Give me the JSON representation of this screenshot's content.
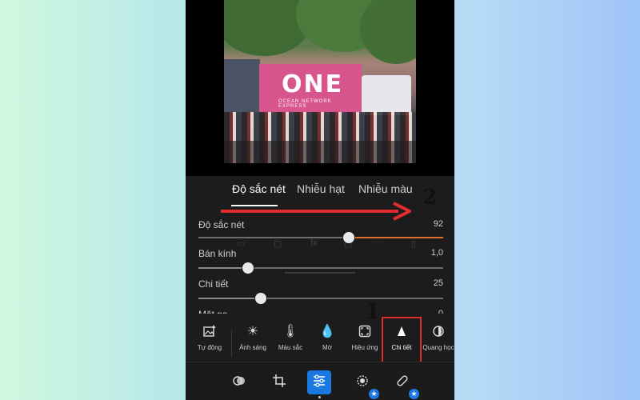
{
  "tabs": [
    "Độ sắc nét",
    "Nhiễu hạt",
    "Nhiễu màu"
  ],
  "active_tab": 0,
  "photo": {
    "container_logo": "ONE",
    "container_subtext": "OCEAN NETWORK EXPRESS"
  },
  "sliders": [
    {
      "label": "Độ sắc nét",
      "value": "92",
      "level": 0.92,
      "accent": true
    },
    {
      "label": "Bán kính",
      "value": "1,0",
      "level": 0.2,
      "accent": false
    },
    {
      "label": "Chi tiết",
      "value": "25",
      "level": 0.25,
      "accent": false
    },
    {
      "label": "Mặt nạ",
      "value": "0",
      "level": 0.0,
      "accent": false
    }
  ],
  "tools": [
    {
      "name": "tool-auto",
      "icon": "auto-photo-icon",
      "label": "Tự động"
    },
    {
      "name": "tool-light",
      "icon": "sun-icon",
      "label": "Ánh sáng"
    },
    {
      "name": "tool-color",
      "icon": "thermometer-icon",
      "label": "Màu sắc"
    },
    {
      "name": "tool-blur",
      "icon": "droplet-icon",
      "label": "Mờ"
    },
    {
      "name": "tool-effects",
      "icon": "effects-icon",
      "label": "Hiệu ứng"
    },
    {
      "name": "tool-detail",
      "icon": "triangle-icon",
      "label": "Chi tiết"
    },
    {
      "name": "tool-optics",
      "icon": "lens-icon",
      "label": "Quang học"
    }
  ],
  "active_tool": 5,
  "annotations": {
    "step1": "1",
    "step2": "2"
  },
  "colors": {
    "accent": "#e0712c",
    "highlight": "#e02c2c",
    "active_nav": "#1b78e0"
  }
}
